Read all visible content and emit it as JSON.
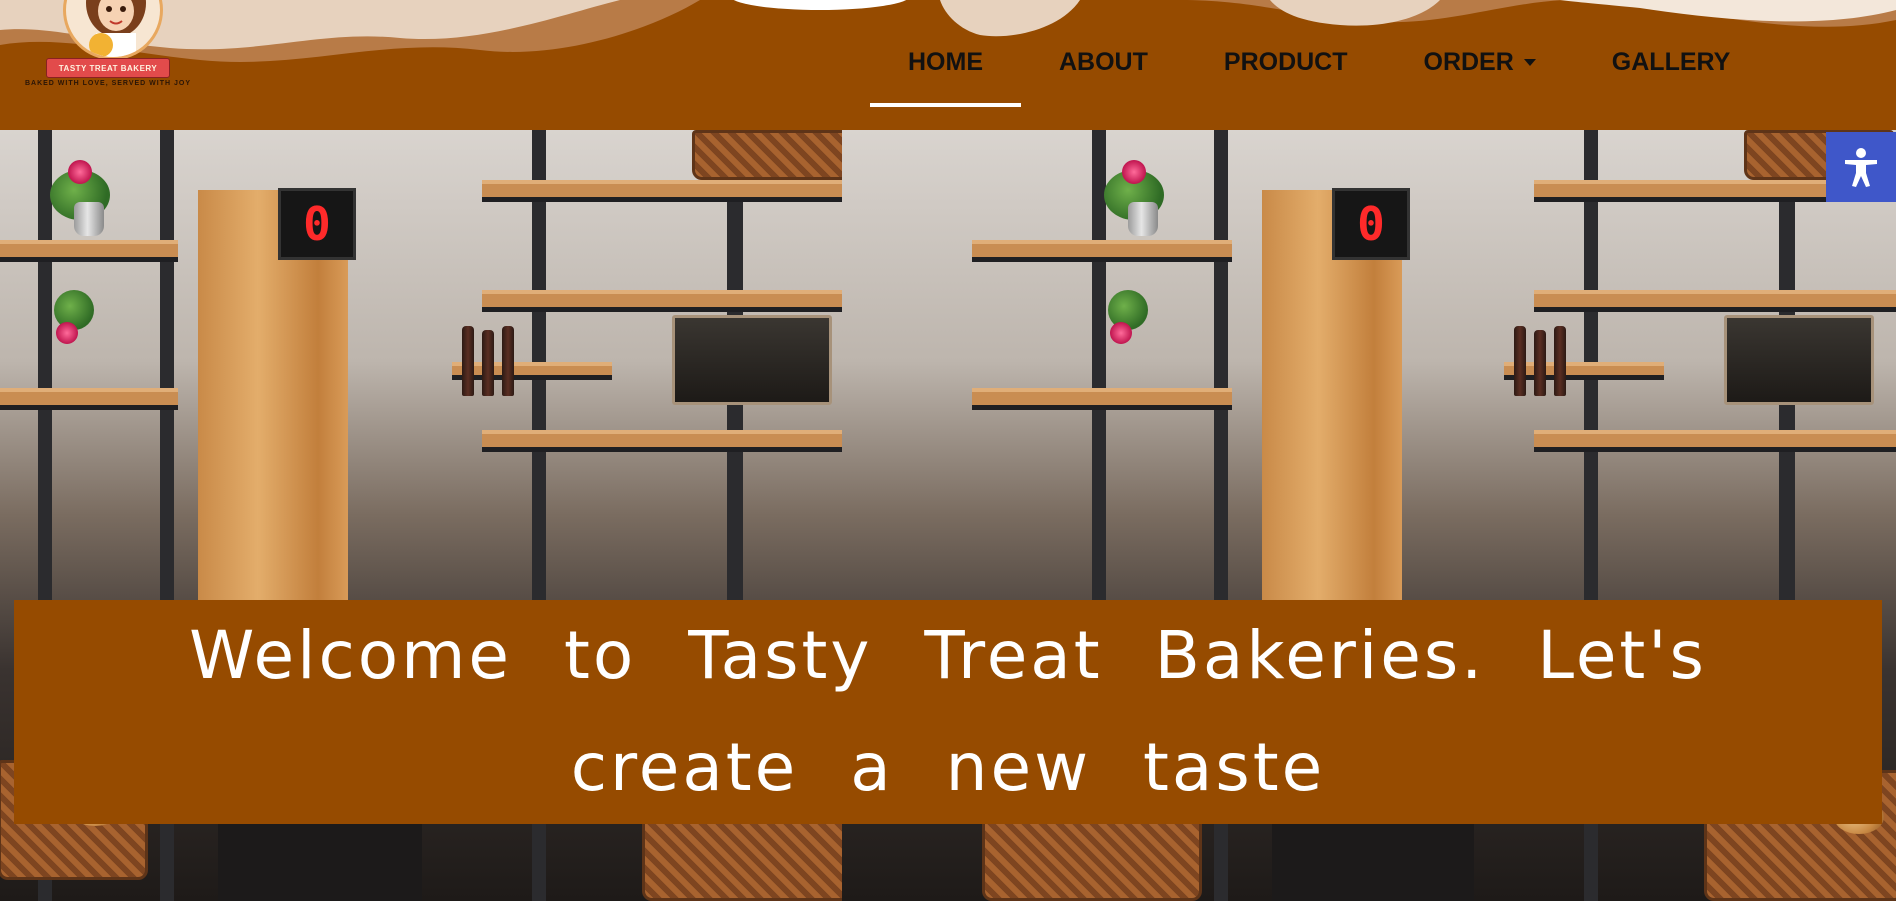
{
  "brand": {
    "name": "TASTY TREAT BAKERY",
    "tagline": "BAKED WITH LOVE, SERVED WITH JOY",
    "colors": {
      "header": "#964b00",
      "wave_light": "#e7d2be",
      "wave_mid": "#b87b47",
      "band": "#964b00",
      "a11y": "#3f57c9",
      "nav_text": "#111111"
    }
  },
  "nav": {
    "items": [
      {
        "label": "HOME",
        "active": true
      },
      {
        "label": "ABOUT",
        "active": false
      },
      {
        "label": "PRODUCT",
        "active": false
      },
      {
        "label": "ORDER",
        "active": false,
        "has_dropdown": true
      },
      {
        "label": "GALLERY",
        "active": false
      }
    ]
  },
  "accessibility": {
    "icon": "accessibility-icon"
  },
  "hero": {
    "welcome": "Welcome to Tasty Treat Bakeries. Let's create a new taste",
    "display_digit": "0"
  }
}
